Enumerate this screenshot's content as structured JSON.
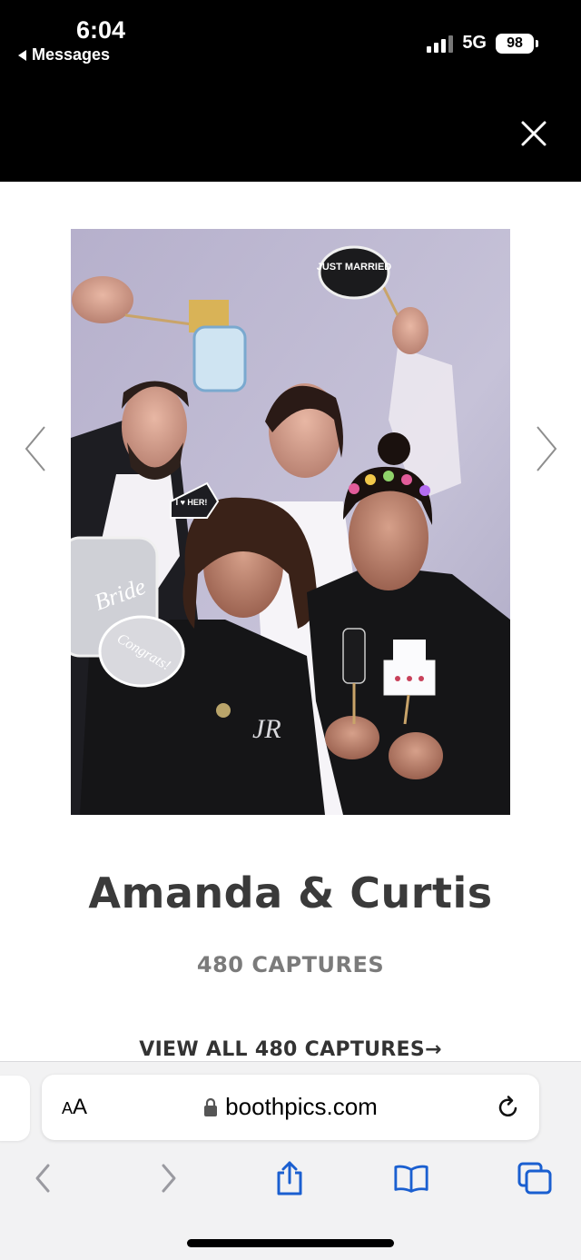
{
  "status_bar": {
    "time": "6:04",
    "back_label": "Messages",
    "network": "5G",
    "battery": "98"
  },
  "colors": {
    "header_bg": "#000000",
    "accent_link": "#1a5fd0",
    "title_text": "#3a3a3a",
    "subtitle_text": "#7b7b7b"
  },
  "gallery": {
    "title": "Amanda & Curtis",
    "capture_count": "480 CAPTURES",
    "view_all": "VIEW ALL 480 CAPTURES",
    "view_all_arrow": "→",
    "photo_props": {
      "sign_top": "JUST MARRIED",
      "sign_arrow": "I ♥ HER!",
      "sign_bubble": "Congrats!",
      "sign_left": "Bride",
      "shirt_logo": "JR"
    }
  },
  "browser": {
    "text_size_big": "A",
    "text_size_small": "A",
    "url": "boothpics.com",
    "icons": [
      "lock-icon",
      "reload-icon",
      "back-icon",
      "forward-icon",
      "share-icon",
      "bookmarks-icon",
      "tabs-icon"
    ]
  }
}
